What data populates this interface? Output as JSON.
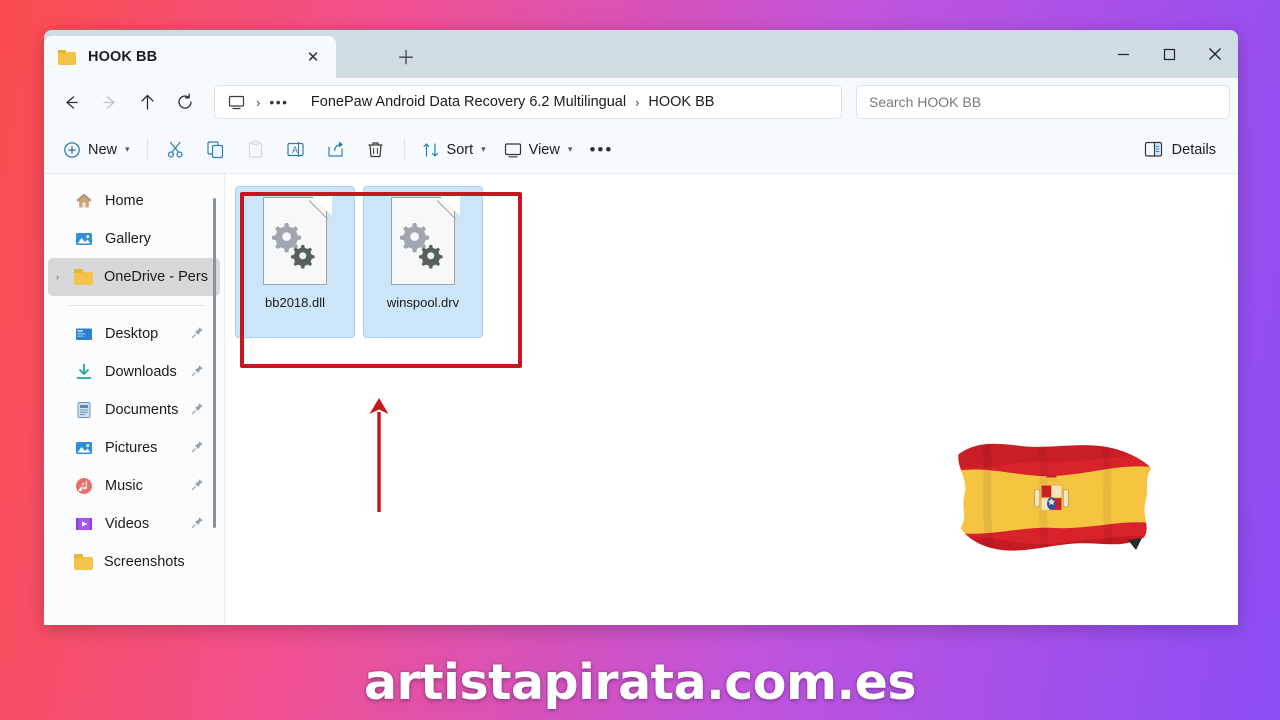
{
  "background": {
    "gradient_from": "#fb4d4d",
    "gradient_to": "#8b4df5"
  },
  "window": {
    "tab": {
      "title": "HOOK BB",
      "folder_icon": "folder-icon",
      "close_icon": "close-icon",
      "close_label": "✕"
    },
    "new_tab": {
      "icon": "plus-icon",
      "label": "＋"
    },
    "controls": {
      "minimize": "–",
      "maximize": "□",
      "close": "✕"
    }
  },
  "nav": {
    "back": {
      "name": "back-arrow-icon",
      "glyph": "←",
      "enabled": true
    },
    "forward": {
      "name": "forward-arrow-icon",
      "glyph": "→",
      "enabled": false
    },
    "up": {
      "name": "up-arrow-icon",
      "glyph": "↑",
      "enabled": true
    },
    "refresh": {
      "name": "refresh-icon",
      "glyph": "⟳",
      "enabled": true
    }
  },
  "breadcrumb": {
    "pc_icon": "this-pc-icon",
    "separator": "›",
    "overflow": "•••",
    "items": [
      "FonePaw Android Data Recovery 6.2 Multilingual",
      "HOOK BB"
    ]
  },
  "search": {
    "placeholder": "Search HOOK BB",
    "value": ""
  },
  "toolbar": {
    "new_label": "New",
    "new_icon": "plus-circle-icon",
    "chevron": "⌄",
    "cut_icon": "scissors-icon",
    "copy_icon": "copy-icon",
    "paste_icon": "paste-icon",
    "rename_icon": "rename-icon",
    "share_icon": "share-icon",
    "delete_icon": "trash-icon",
    "sort_label": "Sort",
    "sort_icon": "sort-icon",
    "view_label": "View",
    "view_icon": "view-icon",
    "more_label": "•••",
    "more_icon": "more-options-icon",
    "details_label": "Details",
    "details_icon": "details-pane-icon"
  },
  "sidebar": {
    "scrollbar": "vertical-scrollbar",
    "items": [
      {
        "label": "Home",
        "icon": "home-icon",
        "pinned": false,
        "selected": false,
        "expandable": false
      },
      {
        "label": "Gallery",
        "icon": "gallery-icon",
        "pinned": false,
        "selected": false,
        "expandable": false
      },
      {
        "label": "OneDrive - Pers",
        "icon": "onedrive-folder-icon",
        "pinned": false,
        "selected": true,
        "expandable": true,
        "chevron": "›"
      },
      {
        "label": "Desktop",
        "icon": "desktop-icon",
        "pinned": true,
        "selected": false,
        "expandable": false
      },
      {
        "label": "Downloads",
        "icon": "downloads-icon",
        "pinned": true,
        "selected": false,
        "expandable": false
      },
      {
        "label": "Documents",
        "icon": "documents-icon",
        "pinned": true,
        "selected": false,
        "expandable": false
      },
      {
        "label": "Pictures",
        "icon": "pictures-icon",
        "pinned": true,
        "selected": false,
        "expandable": false
      },
      {
        "label": "Music",
        "icon": "music-icon",
        "pinned": true,
        "selected": false,
        "expandable": false
      },
      {
        "label": "Videos",
        "icon": "videos-icon",
        "pinned": true,
        "selected": false,
        "expandable": false
      },
      {
        "label": "Screenshots",
        "icon": "folder-icon",
        "pinned": false,
        "selected": false,
        "expandable": false
      }
    ],
    "pin_glyph": "📌"
  },
  "files": [
    {
      "name": "bb2018.dll",
      "icon": "system-file-gears-icon",
      "selected": true
    },
    {
      "name": "winspool.drv",
      "icon": "system-file-gears-icon",
      "selected": true
    }
  ],
  "annotations": {
    "highlight_box": {
      "name": "red-highlight-box",
      "color": "#c5171e"
    },
    "arrow": {
      "name": "red-up-arrow",
      "color": "#c5171e",
      "direction": "up"
    },
    "flag": {
      "name": "spain-flag-graphic"
    }
  },
  "watermark": {
    "text": "artistapirata.com.es"
  }
}
